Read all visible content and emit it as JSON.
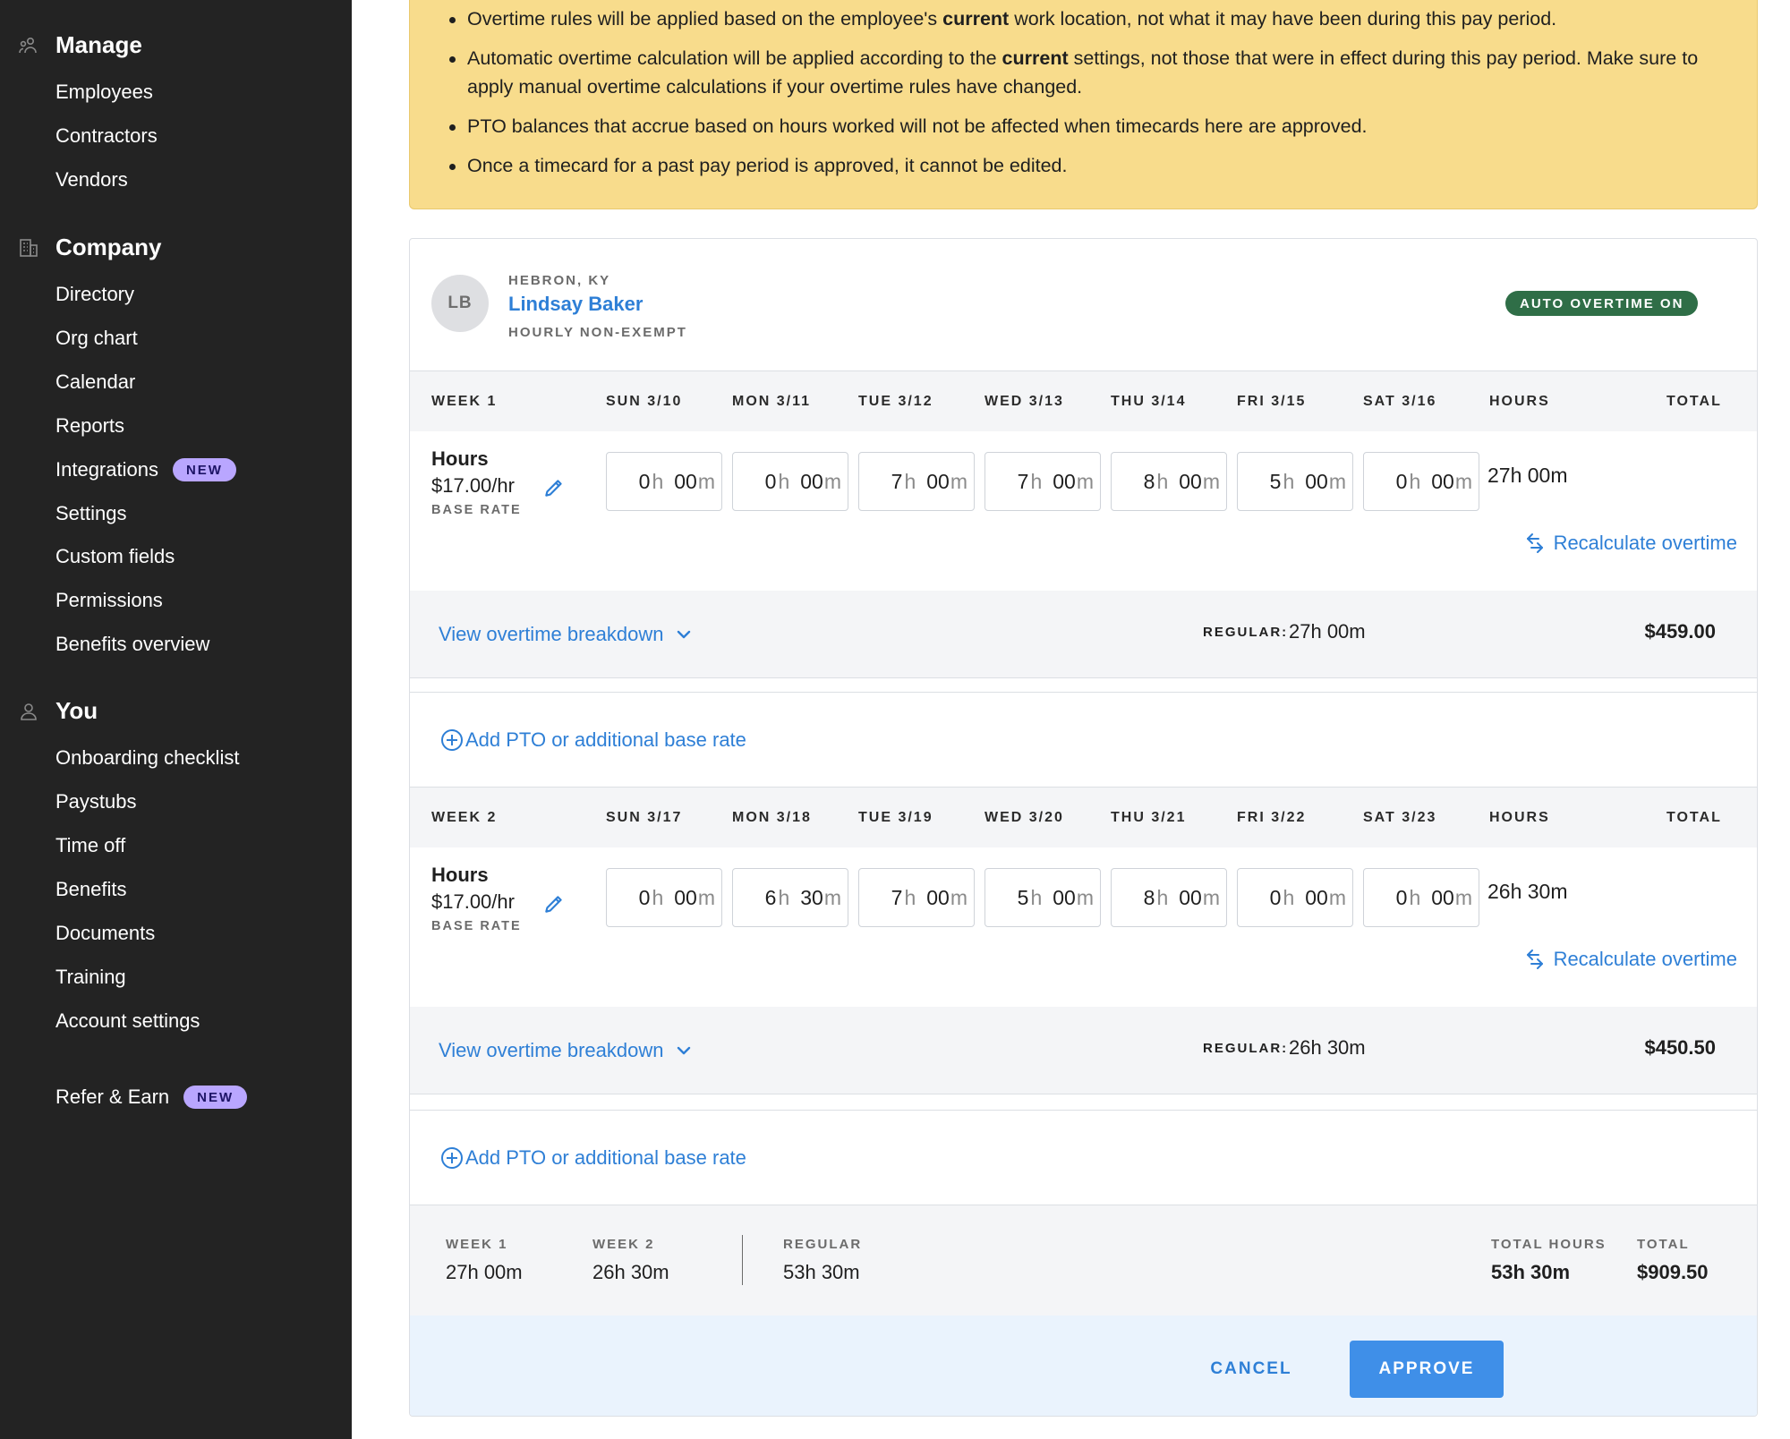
{
  "sidebar": {
    "manage": {
      "title": "Manage",
      "icon": "people-manage-icon",
      "items": [
        {
          "label": "Employees"
        },
        {
          "label": "Contractors"
        },
        {
          "label": "Vendors"
        }
      ]
    },
    "company": {
      "title": "Company",
      "icon": "building-icon",
      "items": [
        {
          "label": "Directory"
        },
        {
          "label": "Org chart"
        },
        {
          "label": "Calendar"
        },
        {
          "label": "Reports"
        },
        {
          "label": "Integrations",
          "badge": "NEW"
        },
        {
          "label": "Settings"
        },
        {
          "label": "Custom fields"
        },
        {
          "label": "Permissions"
        },
        {
          "label": "Benefits overview"
        }
      ]
    },
    "you": {
      "title": "You",
      "icon": "person-icon",
      "items": [
        {
          "label": "Onboarding checklist"
        },
        {
          "label": "Paystubs"
        },
        {
          "label": "Time off"
        },
        {
          "label": "Benefits"
        },
        {
          "label": "Documents"
        },
        {
          "label": "Training"
        },
        {
          "label": "Account settings"
        }
      ]
    },
    "refer": {
      "label": "Refer & Earn",
      "badge": "NEW"
    }
  },
  "notice": {
    "bullets": [
      {
        "before": "Overtime rules will be applied based on the employee's ",
        "bold": "current",
        "after": " work location, not what it may have been during this pay period."
      },
      {
        "before": "Automatic overtime calculation will be applied according to the ",
        "bold": "current",
        "after": " settings, not those that were in effect during this pay period. Make sure to apply manual overtime calculations if your overtime rules have changed."
      },
      {
        "before": "PTO balances that accrue based on hours worked will not be affected when timecards here are approved.",
        "bold": "",
        "after": ""
      },
      {
        "before": "Once a timecard for a past pay period is approved, it cannot be edited.",
        "bold": "",
        "after": ""
      }
    ]
  },
  "employee": {
    "initials": "LB",
    "location": "HEBRON, KY",
    "name": "Lindsay Baker",
    "type": "HOURLY NON-EXEMPT",
    "overtime_badge": "AUTO OVERTIME ON"
  },
  "weeks": [
    {
      "label": "WEEK 1",
      "days": [
        "SUN 3/10",
        "MON 3/11",
        "TUE 3/12",
        "WED 3/13",
        "THU 3/14",
        "FRI 3/15",
        "SAT 3/16"
      ],
      "hours_header": "HOURS",
      "total_header": "TOTAL",
      "row_title": "Hours",
      "rate": "$17.00/hr",
      "rate_label": "BASE RATE",
      "entries": [
        {
          "h": "0",
          "m": "00"
        },
        {
          "h": "0",
          "m": "00"
        },
        {
          "h": "7",
          "m": "00"
        },
        {
          "h": "7",
          "m": "00"
        },
        {
          "h": "8",
          "m": "00"
        },
        {
          "h": "5",
          "m": "00"
        },
        {
          "h": "0",
          "m": "00"
        }
      ],
      "unit_h": "h",
      "unit_m": "m",
      "hours_total": "27h 00m",
      "recalc": "Recalculate overtime",
      "breakdown_link": "View overtime breakdown",
      "regular_label": "REGULAR:",
      "regular_value": "27h 00m",
      "pay_total": "$459.00",
      "add_pto": "Add PTO or additional base rate"
    },
    {
      "label": "WEEK 2",
      "days": [
        "SUN 3/17",
        "MON 3/18",
        "TUE 3/19",
        "WED 3/20",
        "THU 3/21",
        "FRI 3/22",
        "SAT 3/23"
      ],
      "hours_header": "HOURS",
      "total_header": "TOTAL",
      "row_title": "Hours",
      "rate": "$17.00/hr",
      "rate_label": "BASE RATE",
      "entries": [
        {
          "h": "0",
          "m": "00"
        },
        {
          "h": "6",
          "m": "30"
        },
        {
          "h": "7",
          "m": "00"
        },
        {
          "h": "5",
          "m": "00"
        },
        {
          "h": "8",
          "m": "00"
        },
        {
          "h": "0",
          "m": "00"
        },
        {
          "h": "0",
          "m": "00"
        }
      ],
      "unit_h": "h",
      "unit_m": "m",
      "hours_total": "26h 30m",
      "recalc": "Recalculate overtime",
      "breakdown_link": "View overtime breakdown",
      "regular_label": "REGULAR:",
      "regular_value": "26h 30m",
      "pay_total": "$450.50",
      "add_pto": "Add PTO or additional base rate"
    }
  ],
  "summary": {
    "week1_label": "WEEK 1",
    "week1_value": "27h 00m",
    "week2_label": "WEEK 2",
    "week2_value": "26h 30m",
    "regular_label": "REGULAR",
    "regular_value": "53h 30m",
    "total_hours_label": "TOTAL HOURS",
    "total_hours_value": "53h 30m",
    "total_label": "TOTAL",
    "total_value": "$909.50"
  },
  "actions": {
    "cancel": "CANCEL",
    "approve": "APPROVE"
  },
  "colors": {
    "sidebar_bg": "#232323",
    "notice_bg": "#f8dc8c",
    "link_blue": "#2e7fd6",
    "approve_bg": "#3f8fe8",
    "overtime_badge_bg": "#2f6e47",
    "new_badge_bg": "#b9a6ff"
  }
}
